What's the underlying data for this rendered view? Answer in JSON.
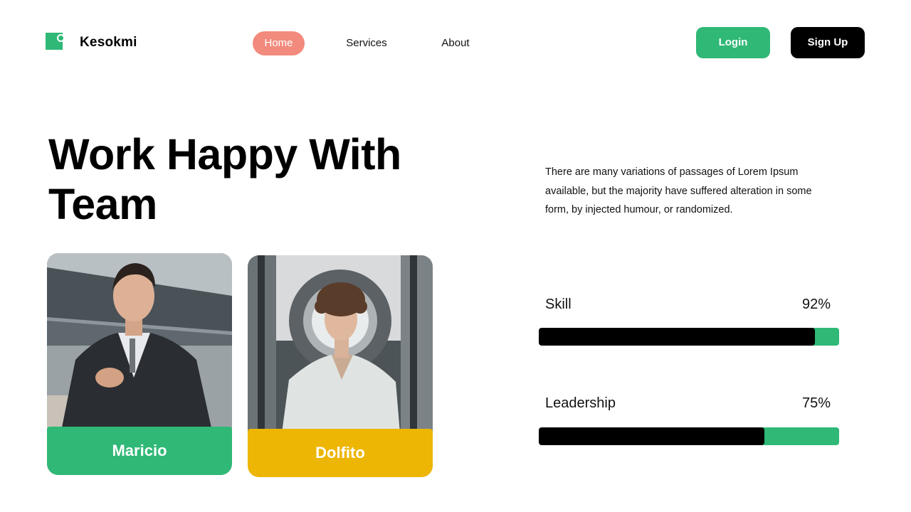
{
  "brand": {
    "name": "Kesokmi",
    "accent": "#2fb876"
  },
  "nav": {
    "items": [
      {
        "label": "Home",
        "active": true
      },
      {
        "label": "Services",
        "active": false
      },
      {
        "label": "About",
        "active": false
      }
    ]
  },
  "auth": {
    "login_label": "Login",
    "signup_label": "Sign Up"
  },
  "hero": {
    "title_line1": "Work Happy With",
    "title_line2": "Team",
    "description": "There are many variations of passages of Lorem Ipsum available, but the majority have suffered alteration in some form, by injected humour, or randomized."
  },
  "team": [
    {
      "name": "Maricio",
      "label_color": "#2fb876"
    },
    {
      "name": "Dolfito",
      "label_color": "#edb604"
    }
  ],
  "skills": [
    {
      "name": "Skill",
      "percent_label": "92%",
      "value": 0.92
    },
    {
      "name": "Leadership",
      "percent_label": "75%",
      "value": 0.75
    }
  ],
  "colors": {
    "home_pill": "#f28b7d",
    "signup_bg": "#000000",
    "bar_track": "#2fb876",
    "bar_fill": "#000000"
  }
}
